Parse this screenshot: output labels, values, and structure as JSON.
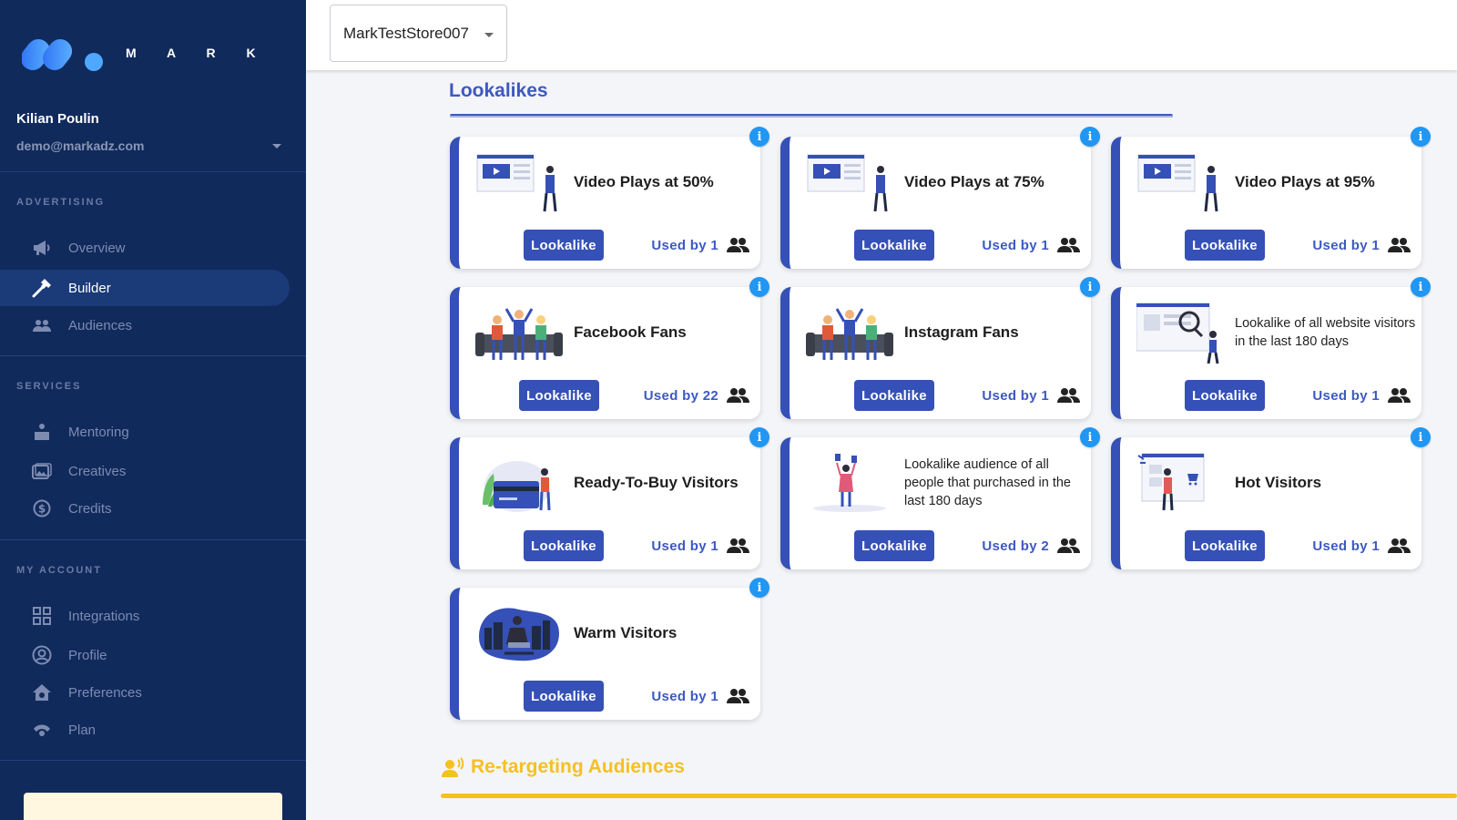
{
  "app": {
    "brand": "M A R K",
    "colors": {
      "sidebar": "#102a5c",
      "accent": "#3550b6",
      "info": "#2196f3",
      "retarget": "#f5c022"
    }
  },
  "user": {
    "name": "Kilian Poulin",
    "email": "demo@markadz.com"
  },
  "sidebar": {
    "sections": [
      {
        "label": "ADVERTISING",
        "items": [
          {
            "label": "Overview",
            "icon": "megaphone-icon",
            "active": false
          },
          {
            "label": "Builder",
            "icon": "hammer-icon",
            "active": true
          },
          {
            "label": "Audiences",
            "icon": "group-icon",
            "active": false
          }
        ]
      },
      {
        "label": "SERVICES",
        "items": [
          {
            "label": "Mentoring",
            "icon": "mentoring-icon",
            "active": false
          },
          {
            "label": "Creatives",
            "icon": "creatives-icon",
            "active": false
          },
          {
            "label": "Credits",
            "icon": "dollar-icon",
            "active": false
          }
        ]
      },
      {
        "label": "MY ACCOUNT",
        "items": [
          {
            "label": "Integrations",
            "icon": "integrations-icon",
            "active": false
          },
          {
            "label": "Profile",
            "icon": "profile-icon",
            "active": false
          },
          {
            "label": "Preferences",
            "icon": "preferences-icon",
            "active": false
          },
          {
            "label": "Plan",
            "icon": "plan-icon",
            "active": false
          }
        ]
      }
    ]
  },
  "topbar": {
    "store": "MarkTestStore007"
  },
  "lookalikes": {
    "title": "Lookalikes",
    "button_label": "Lookalike",
    "used_prefix": "Used by",
    "cards": [
      {
        "title": "Video Plays at 50%",
        "desc": false,
        "used_by": "1",
        "illustration": "video-illustration"
      },
      {
        "title": "Video Plays at 75%",
        "desc": false,
        "used_by": "1",
        "illustration": "video-illustration"
      },
      {
        "title": "Video Plays at 95%",
        "desc": false,
        "used_by": "1",
        "illustration": "video-illustration"
      },
      {
        "title": "Facebook Fans",
        "desc": false,
        "used_by": "22",
        "illustration": "fans-illustration"
      },
      {
        "title": "Instagram Fans",
        "desc": false,
        "used_by": "1",
        "illustration": "fans-illustration"
      },
      {
        "title": "Lookalike of all website visitors in the last 180 days",
        "desc": true,
        "used_by": "1",
        "illustration": "website-illustration"
      },
      {
        "title": "Ready-To-Buy Visitors",
        "desc": false,
        "used_by": "1",
        "illustration": "card-illustration"
      },
      {
        "title": "Lookalike audience of all people that purchased in the last 180 days",
        "desc": true,
        "used_by": "2",
        "illustration": "shopping-illustration"
      },
      {
        "title": "Hot Visitors",
        "desc": false,
        "used_by": "1",
        "illustration": "cart-illustration"
      },
      {
        "title": "Warm Visitors",
        "desc": false,
        "used_by": "1",
        "illustration": "night-illustration"
      }
    ]
  },
  "retargeting": {
    "title": "Re-targeting Audiences"
  }
}
